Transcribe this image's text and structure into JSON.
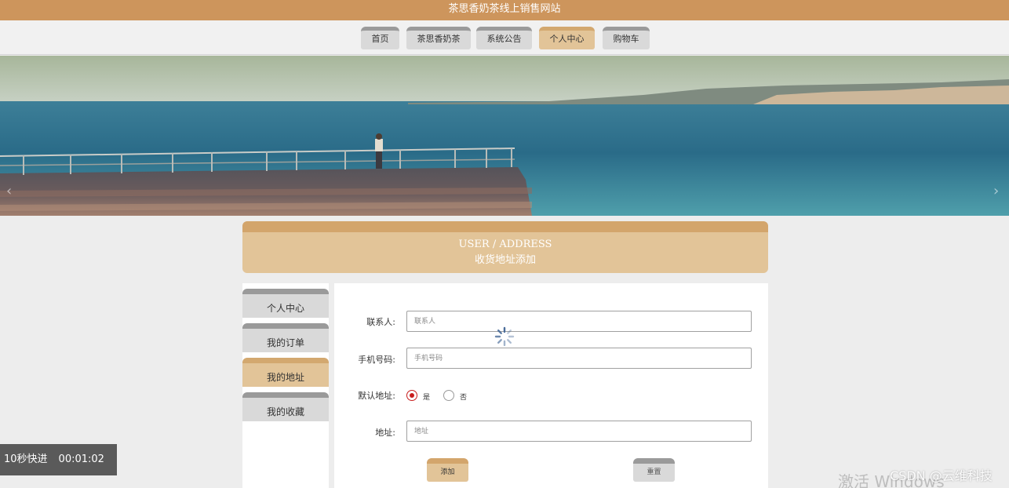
{
  "site": {
    "title": "茶思香奶茶线上销售网站"
  },
  "nav": {
    "items": [
      "首页",
      "茶思香奶茶",
      "系统公告",
      "个人中心",
      "购物车"
    ],
    "active_index": 3
  },
  "banner": {
    "prev_icon": "chevron-left-icon",
    "next_icon": "chevron-right-icon"
  },
  "section": {
    "title_en": "USER / ADDRESS",
    "title_cn": "收货地址添加"
  },
  "sidebar": {
    "items": [
      "个人中心",
      "我的订单",
      "我的地址",
      "我的收藏"
    ],
    "active_index": 2
  },
  "form": {
    "contact": {
      "label": "联系人:",
      "placeholder": "联系人",
      "value": ""
    },
    "phone": {
      "label": "手机号码:",
      "placeholder": "手机号码",
      "value": ""
    },
    "default_address": {
      "label": "默认地址:",
      "options": [
        "是",
        "否"
      ],
      "selected": "是"
    },
    "address": {
      "label": "地址:",
      "placeholder": "地址",
      "value": ""
    },
    "submit_label": "添加",
    "reset_label": "重置"
  },
  "video_overlay": {
    "skip_label": "10秒快进",
    "time": "00:01:02"
  },
  "watermarks": {
    "windows": "激活 Windows",
    "csdn": "CSDN @云维科技"
  },
  "colors": {
    "brand": "#cd955c",
    "accent": "#e2c498",
    "accent_dark": "#d3a56c",
    "inactive": "#d9d9d9",
    "radio_selected": "#c81d1d"
  }
}
